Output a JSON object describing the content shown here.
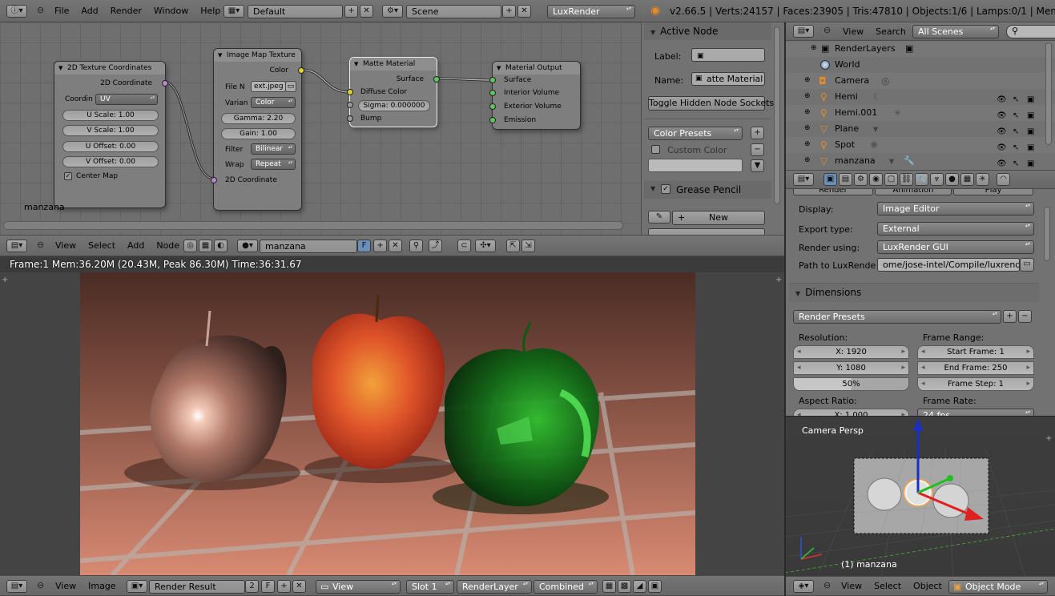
{
  "top_header": {
    "menus": [
      "File",
      "Add",
      "Render",
      "Window",
      "Help"
    ],
    "screen_layout": "Default",
    "scene": "Scene",
    "render_engine": "LuxRender",
    "stats": "v2.66.5 | Verts:24157 | Faces:23905 | Tris:47810 | Objects:1/6 | Lamps:0/1 | Mem:36.77M (20"
  },
  "node_editor": {
    "material_name": "manzana",
    "header_menus": [
      "View",
      "Select",
      "Add",
      "Node"
    ],
    "header_material": "manzana",
    "header_f": "F",
    "nodes": {
      "tex_coords": {
        "title": "2D Texture Coordinates",
        "output": "2D Coordinate",
        "coord_label": "Coordin",
        "coord_value": "UV",
        "u_scale": "U Scale: 1.00",
        "v_scale": "V Scale: 1.00",
        "u_offset": "U Offset: 0.00",
        "v_offset": "V Offset: 0.00",
        "center_map": "Center Map"
      },
      "image_map": {
        "title": "Image Map Texture",
        "output": "Color",
        "file_label": "File N",
        "file_value": "ext.jpeg",
        "variant_label": "Varian",
        "variant_value": "Color",
        "gamma": "Gamma: 2.20",
        "gain": "Gain: 1.00",
        "filter_label": "Filter",
        "filter_value": "Bilinear",
        "wrap_label": "Wrap",
        "wrap_value": "Repeat",
        "input": "2D Coordinate"
      },
      "matte": {
        "title": "Matte Material",
        "output": "Surface",
        "diffuse": "Diffuse Color",
        "sigma": "Sigma: 0.000000",
        "bump": "Bump"
      },
      "output": {
        "title": "Material Output",
        "surface": "Surface",
        "interior": "Interior Volume",
        "exterior": "Exterior Volume",
        "emission": "Emission"
      }
    }
  },
  "sidebar": {
    "active_node_title": "Active Node",
    "label_label": "Label:",
    "name_label": "Name:",
    "name_value": "atte Material",
    "toggle_button": "Toggle Hidden Node Sockets",
    "color_presets": "Color Presets",
    "custom_color": "Custom Color",
    "grease_pencil": "Grease Pencil",
    "new_button": "New"
  },
  "outliner": {
    "menus": [
      "View",
      "Search"
    ],
    "filter": "All Scenes",
    "items": [
      {
        "name": "RenderLayers"
      },
      {
        "name": "World"
      },
      {
        "name": "Camera"
      },
      {
        "name": "Hemi"
      },
      {
        "name": "Hemi.001"
      },
      {
        "name": "Plane"
      },
      {
        "name": "Spot"
      },
      {
        "name": "manzana"
      }
    ]
  },
  "properties": {
    "tabs_partial": [
      "Render",
      "Animation",
      "Play"
    ],
    "display_label": "Display:",
    "display_value": "Image Editor",
    "export_label": "Export type:",
    "export_value": "External",
    "render_using_label": "Render using:",
    "render_using_value": "LuxRender GUI",
    "path_label": "Path to LuxRende",
    "path_value": "ome/jose-intel/Compile/luxrender/",
    "dimensions_title": "Dimensions",
    "render_presets": "Render Presets",
    "resolution_label": "Resolution:",
    "res_x": "X: 1920",
    "res_y": "Y: 1080",
    "res_pct": "50%",
    "frame_range_label": "Frame Range:",
    "start_frame": "Start Frame: 1",
    "end_frame": "End Frame: 250",
    "frame_step": "Frame Step: 1",
    "aspect_label": "Aspect Ratio:",
    "frame_rate_label": "Frame Rate:",
    "aspect_x_partial": "X: 1.000",
    "frame_rate_partial": "24 fps"
  },
  "image_editor": {
    "info": "Frame:1 Mem:36.20M (20.43M, Peak 86.30M) Time:36:31.67",
    "menus": [
      "View",
      "Image"
    ],
    "image_name": "Render Result",
    "users": "2",
    "f": "F",
    "view": "View",
    "slot": "Slot 1",
    "layer": "RenderLayer",
    "pass": "Combined"
  },
  "viewport": {
    "title": "Camera Persp",
    "object_label": "(1) manzana",
    "menus": [
      "View",
      "Select",
      "Object"
    ],
    "mode": "Object Mode"
  }
}
